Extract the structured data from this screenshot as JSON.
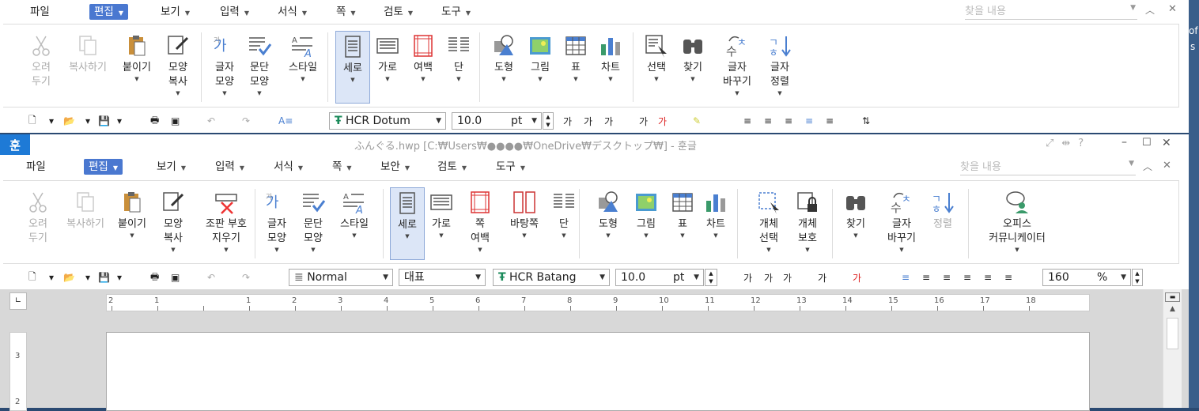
{
  "w1": {
    "menus": [
      {
        "label": "파일"
      },
      {
        "label": "편집",
        "active": true
      },
      {
        "label": "보기"
      },
      {
        "label": "입력"
      },
      {
        "label": "서식"
      },
      {
        "label": "쪽"
      },
      {
        "label": "검토"
      },
      {
        "label": "도구"
      }
    ],
    "search_placeholder": "찾을 내용",
    "ribbon": [
      {
        "label": "오려\n두기",
        "dis": true,
        "icon": "cut-icon"
      },
      {
        "label": "복사하기",
        "dis": true,
        "icon": "copy-icon"
      },
      {
        "label": "붙이기",
        "icon": "paste-icon"
      },
      {
        "label": "모양\n복사",
        "icon": "format-painter-icon"
      },
      {
        "label": "글자\n모양",
        "icon": "char-shape-icon"
      },
      {
        "label": "문단\n모양",
        "icon": "para-shape-icon"
      },
      {
        "label": "스타일",
        "icon": "style-icon"
      },
      {
        "label": "세로",
        "sel": true,
        "icon": "portrait-icon"
      },
      {
        "label": "가로",
        "icon": "landscape-icon"
      },
      {
        "label": "여백",
        "icon": "margin-icon"
      },
      {
        "label": "단",
        "icon": "columns-icon"
      },
      {
        "label": "도형",
        "icon": "shape-icon"
      },
      {
        "label": "그림",
        "icon": "picture-icon"
      },
      {
        "label": "표",
        "icon": "table-icon"
      },
      {
        "label": "차트",
        "icon": "chart-icon"
      },
      {
        "label": "선택",
        "icon": "select-icon"
      },
      {
        "label": "찾기",
        "icon": "find-icon"
      },
      {
        "label": "글자\n바꾸기",
        "icon": "replace-icon"
      },
      {
        "label": "글자\n정렬",
        "icon": "sort-icon"
      }
    ],
    "font": "HCR Dotum",
    "size": "10.0",
    "unit": "pt"
  },
  "w2": {
    "tab": "훈",
    "title": "ふんぐる.hwp [C:₩Users₩●●●●₩OneDrive₩デスクトップ₩] - 훈글",
    "menus": [
      {
        "label": "파일"
      },
      {
        "label": "편집",
        "active": true
      },
      {
        "label": "보기"
      },
      {
        "label": "입력"
      },
      {
        "label": "서식"
      },
      {
        "label": "쪽"
      },
      {
        "label": "보안"
      },
      {
        "label": "검토"
      },
      {
        "label": "도구"
      }
    ],
    "search_placeholder": "찾을 내용",
    "ribbon": [
      {
        "label": "오려\n두기",
        "dis": true,
        "icon": "cut-icon"
      },
      {
        "label": "복사하기",
        "dis": true,
        "icon": "copy-icon"
      },
      {
        "label": "붙이기",
        "icon": "paste-icon"
      },
      {
        "label": "모양\n복사",
        "icon": "format-painter-icon"
      },
      {
        "label": "조판 부호\n지우기",
        "icon": "clear-code-icon"
      },
      {
        "label": "글자\n모양",
        "icon": "char-shape-icon"
      },
      {
        "label": "문단\n모양",
        "icon": "para-shape-icon"
      },
      {
        "label": "스타일",
        "icon": "style-icon"
      },
      {
        "label": "세로",
        "sel": true,
        "icon": "portrait-icon"
      },
      {
        "label": "가로",
        "icon": "landscape-icon"
      },
      {
        "label": "쪽\n여백",
        "icon": "margin-icon"
      },
      {
        "label": "바탕쪽",
        "icon": "master-page-icon"
      },
      {
        "label": "단",
        "icon": "columns-icon"
      },
      {
        "label": "도형",
        "icon": "shape-icon"
      },
      {
        "label": "그림",
        "icon": "picture-icon"
      },
      {
        "label": "표",
        "icon": "table-icon"
      },
      {
        "label": "차트",
        "icon": "chart-icon"
      },
      {
        "label": "개체\n선택",
        "icon": "object-select-icon"
      },
      {
        "label": "개체\n보호",
        "icon": "object-protect-icon"
      },
      {
        "label": "찾기",
        "icon": "find-icon"
      },
      {
        "label": "글자\n바꾸기",
        "icon": "replace-icon"
      },
      {
        "label": "정렬",
        "dis": true,
        "icon": "sort-icon"
      },
      {
        "label": "오피스\n커뮤니케이터",
        "icon": "communicator-icon"
      }
    ],
    "style": "Normal",
    "lang": "대표",
    "font": "HCR Batang",
    "size": "10.0",
    "unit": "pt",
    "zoom": "160",
    "zoom_unit": "%",
    "ruler": [
      "2",
      "1",
      "",
      "1",
      "2",
      "3",
      "4",
      "5",
      "6",
      "7",
      "8",
      "9",
      "10",
      "11",
      "12",
      "13",
      "14",
      "15",
      "16",
      "17",
      "18"
    ],
    "vruler": [
      "3",
      "2"
    ]
  },
  "desktop": {
    "text1": "of",
    "text2": "s"
  }
}
